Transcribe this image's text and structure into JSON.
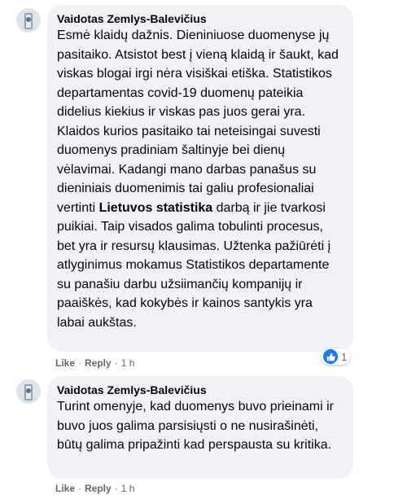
{
  "comments": [
    {
      "author": "Vaidotas Zemlys-Balevičius",
      "text_before": "Esmė klaidų dažnis. Dieniniuose duomenyse jų pasitaiko. Atsistot best į vieną klaidą ir šaukt, kad viskas blogai irgi nėra visiškai etiška. Statistikos departamentas covid-19 duomenų pateikia didelius kiekius ir viskas pas juos gerai yra. Klaidos kurios pasitaiko tai neteisingai suvesti duomenys pradiniam šaltinyje bei dienų vėlavimai. Kadangi mano darbas panašus su dieniniais duomenimis tai galiu profesionaliai vertinti ",
      "text_bold": "Lietuvos statistika",
      "text_after": " darbą ir jie tvarkosi puikiai. Taip visados galima tobulinti procesus, bet yra ir resursų klausimas. Užtenka pažiūrėti į atlyginimus mokamus Statistikos departamente su panašiu darbu užsiimančių kompanijų ir paaiškės, kad kokybės ir kainos santykis yra labai aukštas.",
      "like_label": "Like",
      "reply_label": "Reply",
      "time": "1 h",
      "reaction_count": "1",
      "reaction_icon": "thumbs-up-icon"
    },
    {
      "author": "Vaidotas Zemlys-Balevičius",
      "text": "Turint omenyje, kad duomenys buvo prieinami ir buvo juos galima parsisiųsti o ne nusirašinėti, būtų galima pripažinti kad perspausta su kritika.",
      "like_label": "Like",
      "reply_label": "Reply",
      "time": "1 h"
    }
  ],
  "colors": {
    "bubble": "#f0f2f5",
    "meta": "#65676b",
    "like_blue": "#1877f2"
  }
}
